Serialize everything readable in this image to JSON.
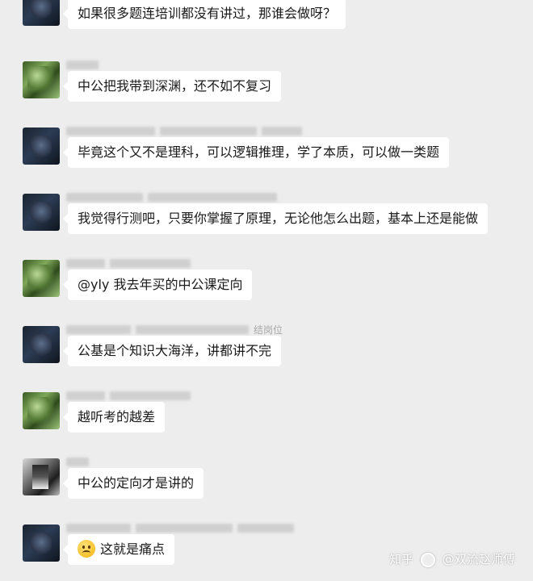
{
  "messages": [
    {
      "avatar": "dark",
      "nick_tail": "",
      "text": "如果很多题连培训都没有讲过，那谁会做呀？"
    },
    {
      "avatar": "green",
      "nick_tail": "",
      "text": "中公把我带到深渊，还不如不复习"
    },
    {
      "avatar": "dark",
      "nick_tail": "",
      "text": "毕竟这个又不是理科，可以逻辑推理，学了本质，可以做一类题"
    },
    {
      "avatar": "dark",
      "nick_tail": "",
      "text": "我觉得行测吧，只要你掌握了原理，无论他怎么出题，基本上还是能做"
    },
    {
      "avatar": "green",
      "nick_tail": "",
      "text": "@yly 我去年买的中公课定向"
    },
    {
      "avatar": "dark",
      "nick_tail": "结岗位",
      "text": "公基是个知识大海洋，讲都讲不完"
    },
    {
      "avatar": "green",
      "nick_tail": "",
      "text": "越听考的越差"
    },
    {
      "avatar": "gray",
      "nick_tail": "",
      "text": "中公的定向才是讲的"
    },
    {
      "avatar": "dark",
      "nick_tail": "",
      "text": "这就是痛点",
      "emoji": "sad-face-emoji"
    }
  ],
  "watermark": {
    "platform": "知乎",
    "author": "@双流赵师傅"
  }
}
